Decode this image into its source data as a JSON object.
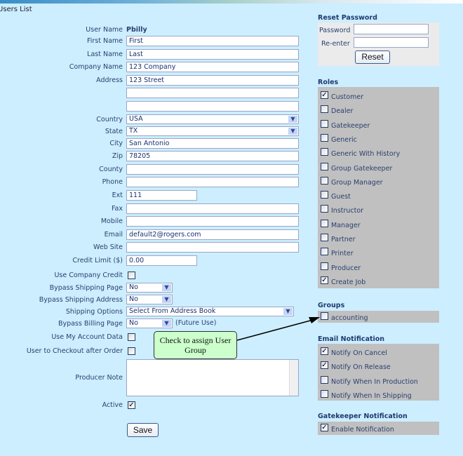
{
  "page_title": "Users List",
  "form": {
    "username_label": "User Name",
    "username": "Pbilly",
    "rows": [
      {
        "label": "First Name",
        "type": "text",
        "value": "First"
      },
      {
        "label": "Last Name",
        "type": "text",
        "value": "Last"
      },
      {
        "label": "Company Name",
        "type": "text",
        "value": "123 Company"
      },
      {
        "label": "Address",
        "type": "text",
        "value": "123 Street"
      },
      {
        "label": "",
        "type": "text",
        "value": ""
      },
      {
        "label": "",
        "type": "text",
        "value": ""
      },
      {
        "label": "Country",
        "type": "select",
        "value": "USA"
      },
      {
        "label": "State",
        "type": "select",
        "value": "TX"
      },
      {
        "label": "City",
        "type": "text",
        "value": "San Antonio"
      },
      {
        "label": "Zip",
        "type": "text",
        "value": "78205"
      },
      {
        "label": "County",
        "type": "text",
        "value": ""
      },
      {
        "label": "Phone",
        "type": "text",
        "value": ""
      },
      {
        "label": "Ext",
        "type": "short",
        "value": "111"
      },
      {
        "label": "Fax",
        "type": "text",
        "value": ""
      },
      {
        "label": "Mobile",
        "type": "text",
        "value": ""
      },
      {
        "label": "Email",
        "type": "text",
        "value": "default2@rogers.com"
      },
      {
        "label": "Web Site",
        "type": "text",
        "value": ""
      },
      {
        "label": "Credit Limit ($)",
        "type": "short",
        "value": "0.00"
      },
      {
        "label": "Use Company Credit",
        "type": "checkbox",
        "checked": false
      },
      {
        "label": "Bypass Shipping Page",
        "type": "smallselect",
        "value": "No"
      },
      {
        "label": "Bypass Shipping Address",
        "type": "smallselect",
        "value": "No"
      },
      {
        "label": "Shipping Options",
        "type": "wideselect",
        "value": "Select From Address Book"
      },
      {
        "label": "Bypass Billing Page",
        "type": "smallselect",
        "value": "No",
        "note": "(Future Use)"
      },
      {
        "label": "Use My Account Data",
        "type": "checkbox",
        "checked": false
      },
      {
        "label": "User to Checkout after Order",
        "type": "checkbox",
        "checked": false
      },
      {
        "label": "Producer Note",
        "type": "textarea",
        "value": ""
      },
      {
        "label": "Active",
        "type": "checkbox",
        "checked": true
      }
    ],
    "save_label": "Save"
  },
  "reset_password": {
    "heading": "Reset Password",
    "password_label": "Password",
    "reenter_label": "Re-enter",
    "reset_label": "Reset"
  },
  "roles": {
    "heading": "Roles",
    "items": [
      {
        "label": "Customer",
        "checked": true
      },
      {
        "label": "Dealer",
        "checked": false
      },
      {
        "label": "Gatekeeper",
        "checked": false
      },
      {
        "label": "Generic",
        "checked": false
      },
      {
        "label": "Generic With History",
        "checked": false
      },
      {
        "label": "Group Gatekeeper",
        "checked": false
      },
      {
        "label": "Group Manager",
        "checked": false
      },
      {
        "label": "Guest",
        "checked": false
      },
      {
        "label": "Instructor",
        "checked": false
      },
      {
        "label": "Manager",
        "checked": false
      },
      {
        "label": "Partner",
        "checked": false
      },
      {
        "label": "Printer",
        "checked": false
      },
      {
        "label": "Producer",
        "checked": false
      },
      {
        "label": "Create Job",
        "checked": true
      }
    ]
  },
  "groups": {
    "heading": "Groups",
    "items": [
      {
        "label": "accounting",
        "checked": false
      }
    ]
  },
  "email_notification": {
    "heading": "Email Notification",
    "items": [
      {
        "label": "Notify On Cancel",
        "checked": true
      },
      {
        "label": "Notify On Release",
        "checked": true
      },
      {
        "label": "Notify When In Production",
        "checked": false
      },
      {
        "label": "Notify When In Shipping",
        "checked": false
      }
    ]
  },
  "gatekeeper_notification": {
    "heading": "Gatekeeper Notification",
    "items": [
      {
        "label": "Enable Notification",
        "checked": true
      }
    ]
  },
  "callout": {
    "text": "Check to assign User Group",
    "background": "#ccffcc"
  }
}
